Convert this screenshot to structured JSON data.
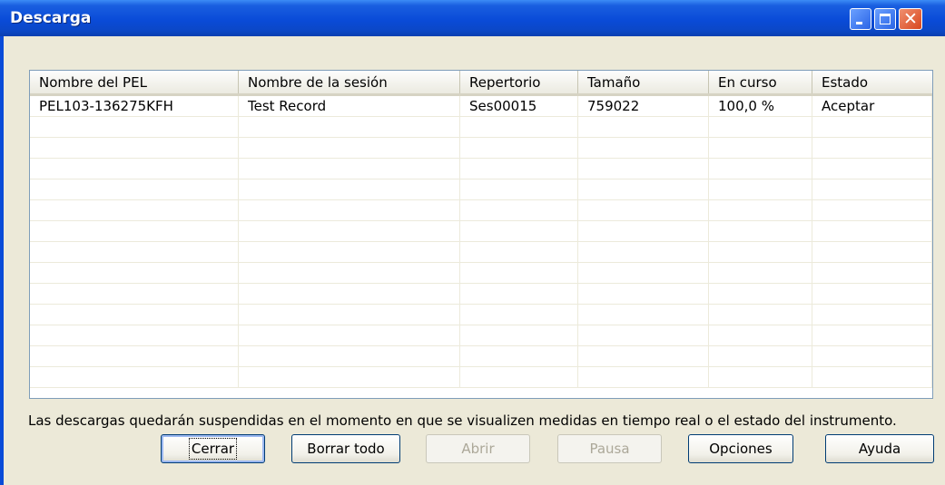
{
  "window": {
    "title": "Descarga"
  },
  "table": {
    "columns": [
      "Nombre del PEL",
      "Nombre de la sesión",
      "Repertorio",
      "Tamaño",
      "En curso",
      "Estado"
    ],
    "rows": [
      [
        "PEL103-136275KFH",
        "Test Record",
        "Ses00015",
        "759022",
        "100,0 %",
        "Aceptar"
      ]
    ]
  },
  "note": "Las descargas quedarán suspendidas en el momento en que se visualizen medidas en tiempo real o el estado del instrumento.",
  "buttons": {
    "close": "Cerrar",
    "clear_all": "Borrar todo",
    "open": "Abrir",
    "pause": "Pausa",
    "options": "Opciones",
    "help": "Ayuda"
  }
}
